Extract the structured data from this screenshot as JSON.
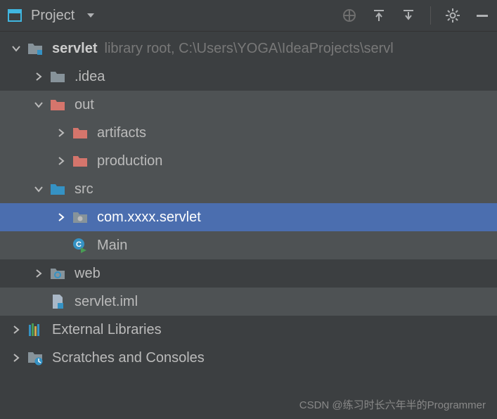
{
  "header": {
    "title": "Project"
  },
  "tree": {
    "root": {
      "label": "servlet",
      "hint": "library root,  C:\\Users\\YOGA\\IdeaProjects\\servl"
    },
    "idea": {
      "label": ".idea"
    },
    "out": {
      "label": "out"
    },
    "artifacts": {
      "label": "artifacts"
    },
    "production": {
      "label": "production"
    },
    "src": {
      "label": "src"
    },
    "package": {
      "label": "com.xxxx.servlet"
    },
    "main": {
      "label": "Main"
    },
    "web": {
      "label": "web"
    },
    "iml": {
      "label": "servlet.iml"
    },
    "ext": {
      "label": "External Libraries"
    },
    "scratch": {
      "label": "Scratches and Consoles"
    }
  },
  "watermark": "CSDN @练习时长六年半的Programmer"
}
